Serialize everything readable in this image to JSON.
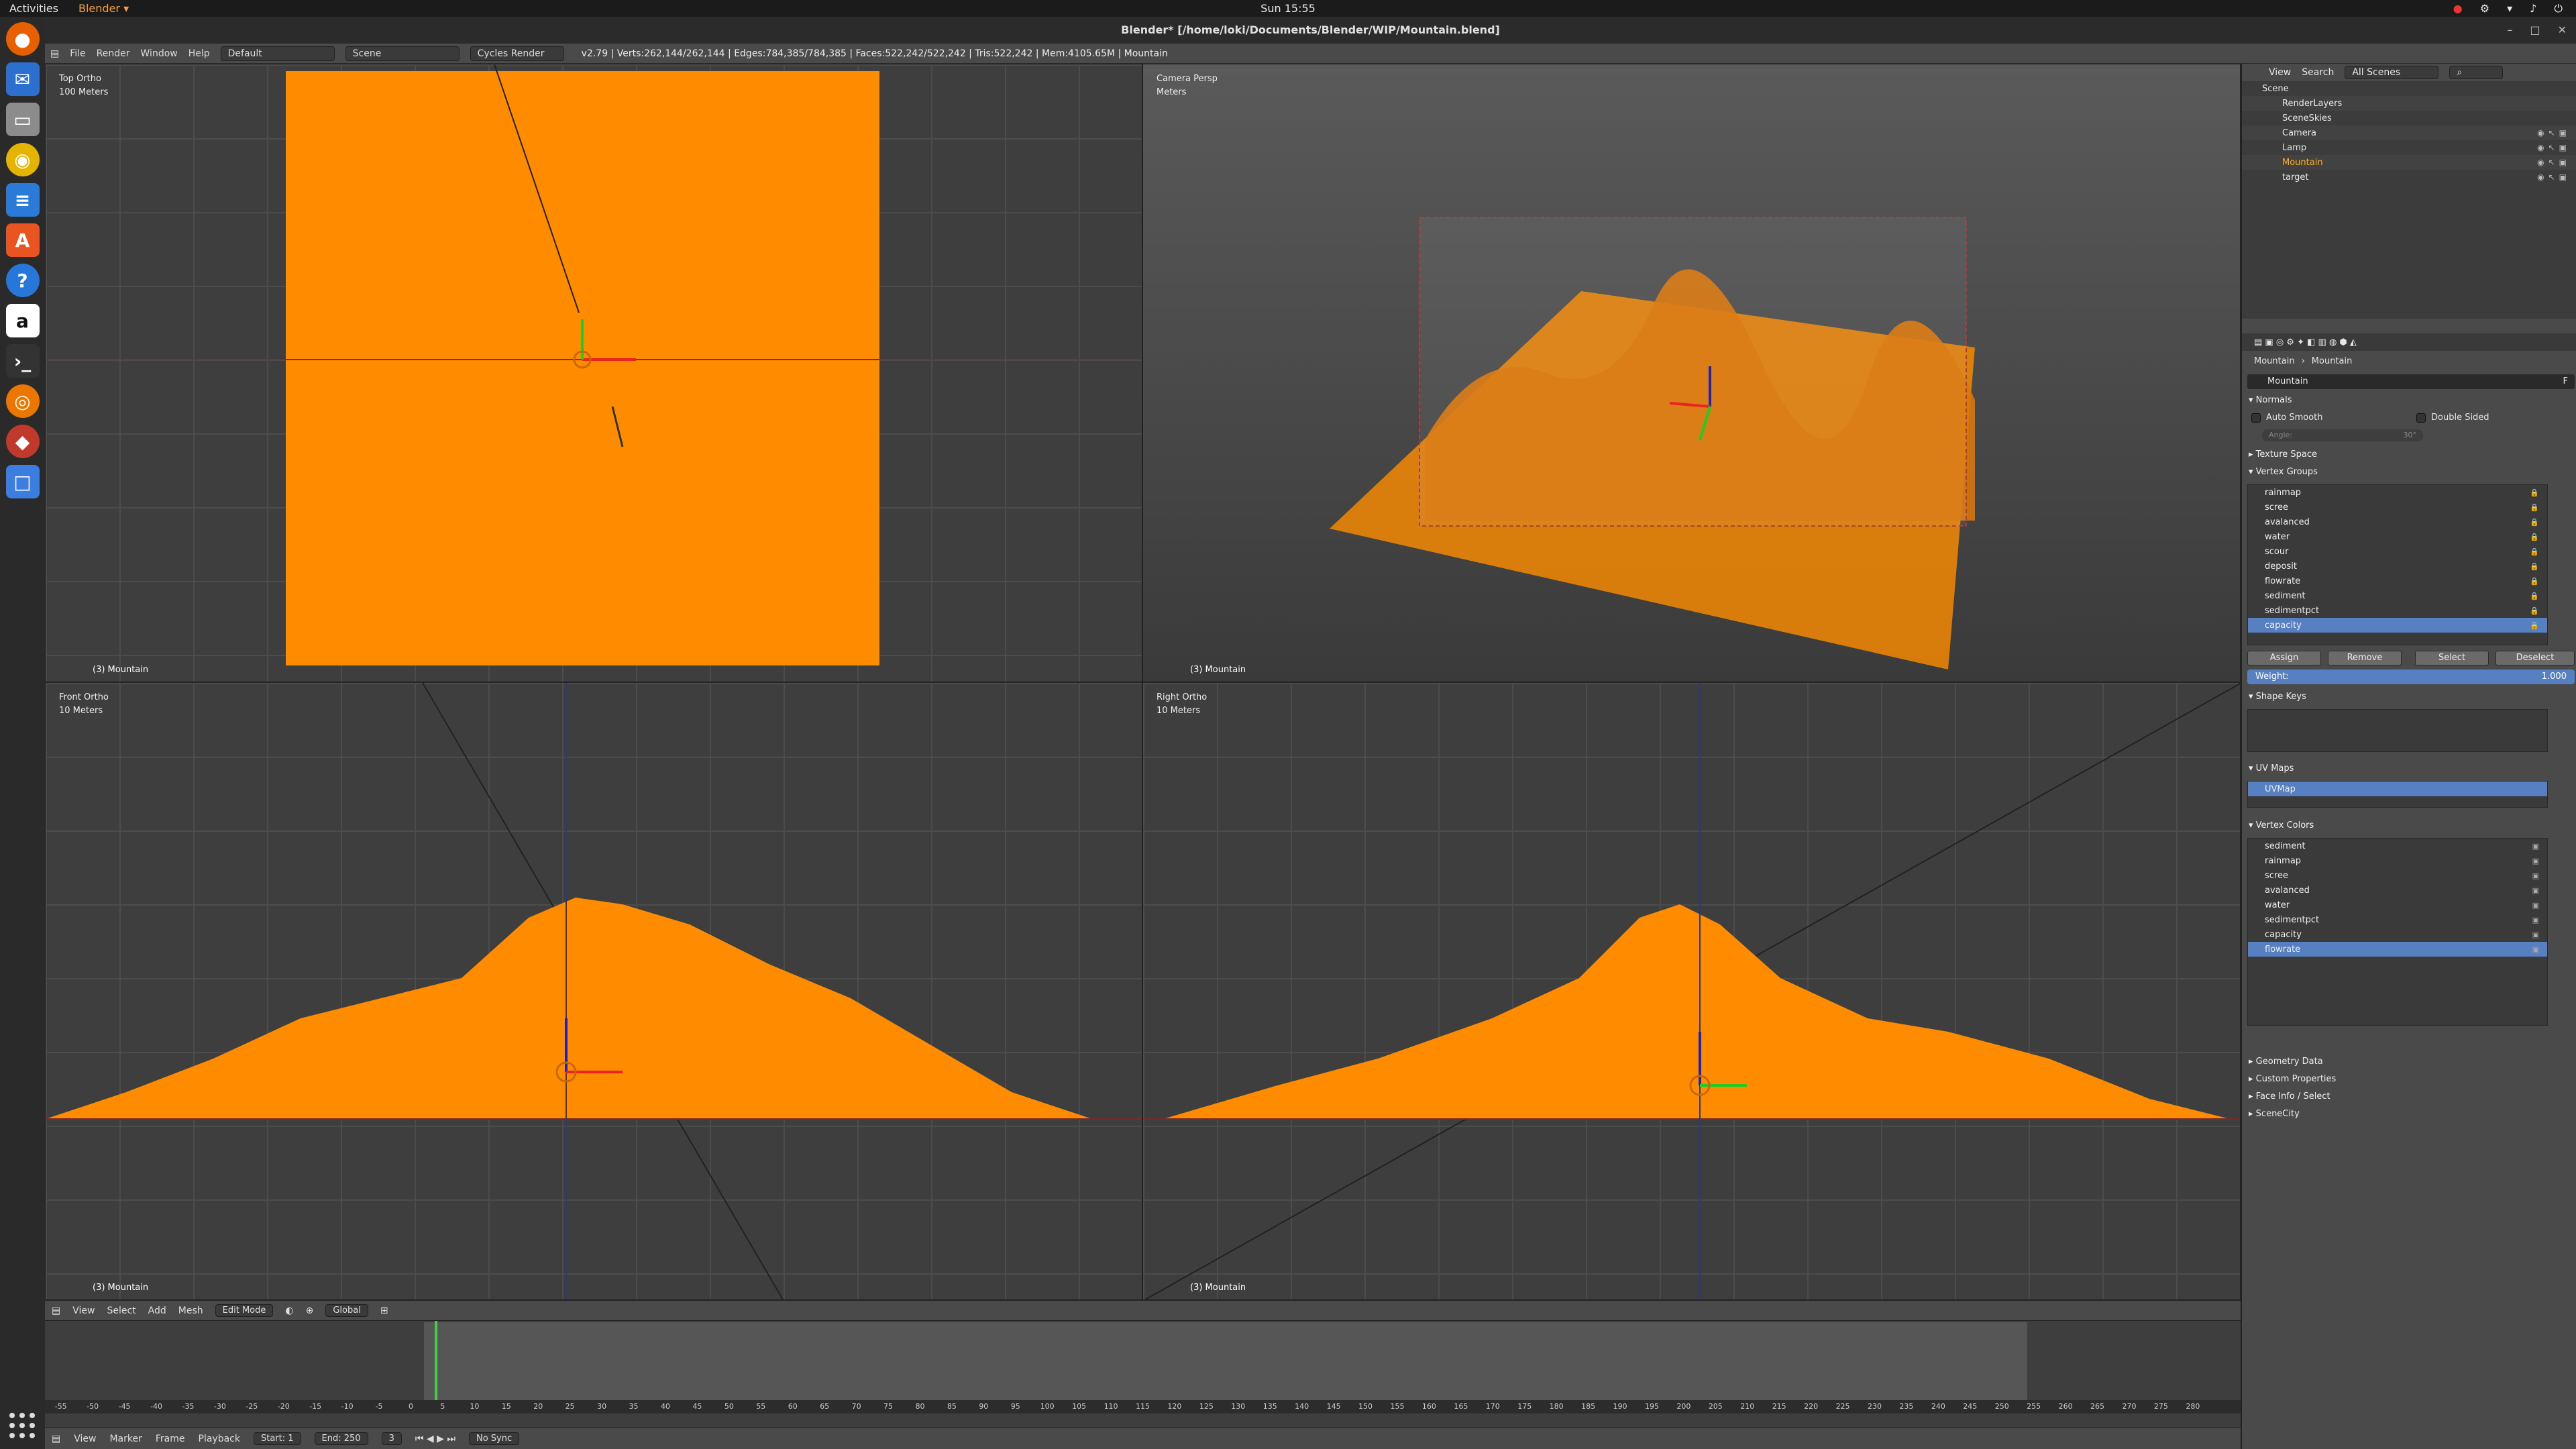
{
  "topbar": {
    "activities": "Activities",
    "app_menu": "Blender ▾",
    "clock": "Sun 15:55"
  },
  "window": {
    "title": "Blender* [/home/loki/Documents/Blender/WIP/Mountain.blend]"
  },
  "infobar": {
    "menus": [
      "File",
      "Render",
      "Window",
      "Help"
    ],
    "layout": "Default",
    "scene": "Scene",
    "engine": "Cycles Render",
    "stats": "v2.79 | Verts:262,144/262,144 | Edges:784,385/784,385 | Faces:522,242/522,242 | Tris:522,242 | Mem:4105.65M | Mountain"
  },
  "viewports": [
    {
      "view": "Top Ortho",
      "scale": "100 Meters",
      "object": "(3) Mountain"
    },
    {
      "view": "Camera Persp",
      "scale": "Meters",
      "object": "(3) Mountain"
    },
    {
      "view": "Front Ortho",
      "scale": "10 Meters",
      "object": "(3) Mountain"
    },
    {
      "view": "Right Ortho",
      "scale": "10 Meters",
      "object": "(3) Mountain"
    }
  ],
  "outliner": {
    "view": "View",
    "search": "Search",
    "filter": "All Scenes",
    "items": [
      "Scene",
      "RenderLayers",
      "SceneSkies",
      "Camera",
      "Lamp",
      "Mountain",
      "target"
    ]
  },
  "properties": {
    "breadcrumb": [
      "Mountain",
      "Mountain"
    ],
    "mesh_name": "Mountain",
    "fake_user": "F",
    "normals": {
      "title": "Normals",
      "auto_smooth": "Auto Smooth",
      "double_sided": "Double Sided",
      "angle_label": "Angle:",
      "angle": "30°"
    },
    "texture_space": "Texture Space",
    "vertex_groups": {
      "title": "Vertex Groups",
      "items": [
        "rainmap",
        "scree",
        "avalanced",
        "water",
        "scour",
        "deposit",
        "flowrate",
        "sediment",
        "sedimentpct",
        "capacity"
      ],
      "selected": "capacity",
      "assign": "Assign",
      "remove": "Remove",
      "select": "Select",
      "deselect": "Deselect",
      "weight_label": "Weight:",
      "weight": "1.000"
    },
    "shape_keys": "Shape Keys",
    "uv_maps": {
      "title": "UV Maps",
      "items": [
        "UVMap"
      ]
    },
    "vertex_colors": {
      "title": "Vertex Colors",
      "items": [
        "sediment",
        "rainmap",
        "scree",
        "avalanced",
        "water",
        "sedimentpct",
        "capacity",
        "flowrate"
      ],
      "selected": "flowrate"
    },
    "collapsed": [
      "Geometry Data",
      "Custom Properties",
      "Face Info / Select",
      "SceneCity"
    ]
  },
  "view3d_header": {
    "menus": [
      "View",
      "Select",
      "Add",
      "Mesh"
    ],
    "mode": "Edit Mode",
    "orientation": "Global"
  },
  "timeline": {
    "ticks": [
      "-55",
      "-50",
      "-45",
      "-40",
      "-35",
      "-30",
      "-25",
      "-20",
      "-15",
      "-10",
      "-5",
      "0",
      "5",
      "10",
      "15",
      "20",
      "25",
      "30",
      "35",
      "40",
      "45",
      "50",
      "55",
      "60",
      "65",
      "70",
      "75",
      "80",
      "85",
      "90",
      "95",
      "100",
      "105",
      "110",
      "115",
      "120",
      "125",
      "130",
      "135",
      "140",
      "145",
      "150",
      "155",
      "160",
      "165",
      "170",
      "175",
      "180",
      "185",
      "190",
      "195",
      "200",
      "205",
      "210",
      "215",
      "220",
      "225",
      "230",
      "235",
      "240",
      "245",
      "250",
      "255",
      "260",
      "265",
      "270",
      "275",
      "280"
    ],
    "menus": [
      "View",
      "Marker",
      "Frame",
      "Playback"
    ],
    "start_label": "Start:",
    "start": "1",
    "end_label": "End:",
    "end": "250",
    "current": "3",
    "sync": "No Sync"
  },
  "colors": {
    "mesh": "#ff8c00",
    "selected": "#5680c2",
    "bg": "#3d3d3d"
  }
}
